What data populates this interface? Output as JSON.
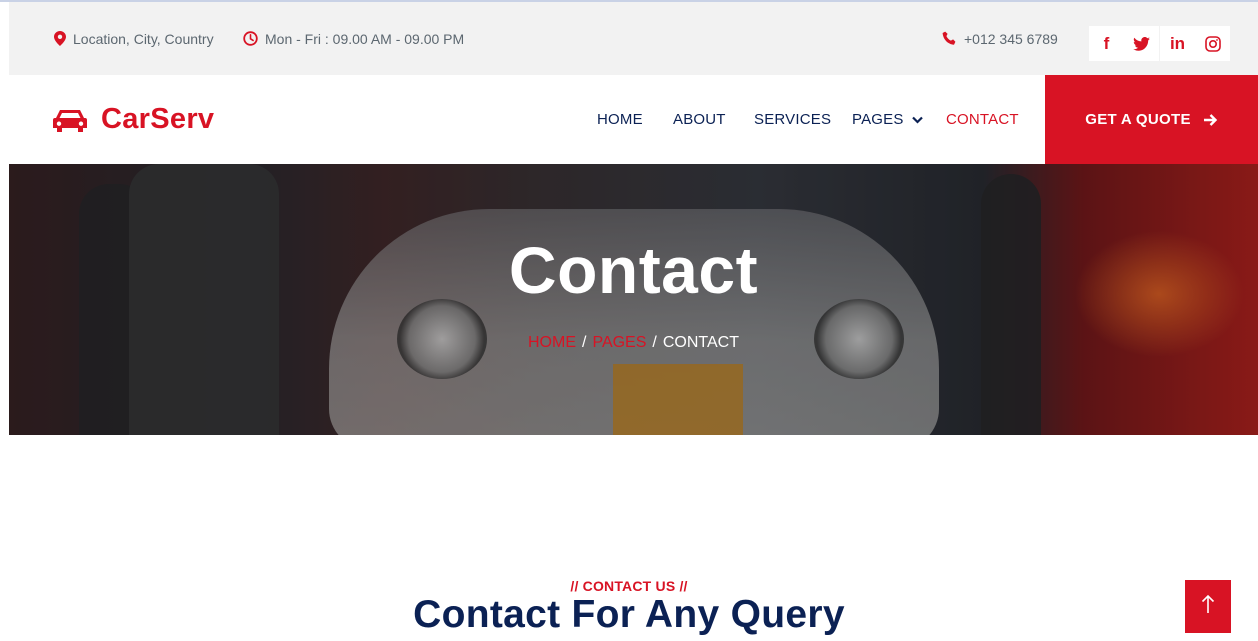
{
  "topbar": {
    "location": "Location, City, Country",
    "hours": "Mon - Fri : 09.00 AM - 09.00 PM",
    "phone": "+012 345 6789",
    "socials": [
      {
        "icon": "facebook-icon",
        "glyph": "f"
      },
      {
        "icon": "twitter-icon"
      },
      {
        "icon": "linkedin-icon",
        "glyph": "in"
      },
      {
        "icon": "instagram-icon"
      }
    ]
  },
  "navbar": {
    "brand": "CarServ",
    "brand_icon": "car-icon",
    "links": {
      "home": "HOME",
      "about": "ABOUT",
      "services": "SERVICES",
      "pages": "PAGES",
      "contact": "CONTACT"
    },
    "active": "contact",
    "cta": "GET A QUOTE"
  },
  "hero": {
    "title": "Contact",
    "breadcrumb": {
      "home": "HOME",
      "pages": "PAGES",
      "current": "CONTACT",
      "separator": "/"
    }
  },
  "section": {
    "subtitle": "// CONTACT US //",
    "title": "Contact For Any Query"
  },
  "colors": {
    "primary": "#D81324",
    "dark": "#0B2154",
    "topbar_bg": "#F2F2F2"
  }
}
